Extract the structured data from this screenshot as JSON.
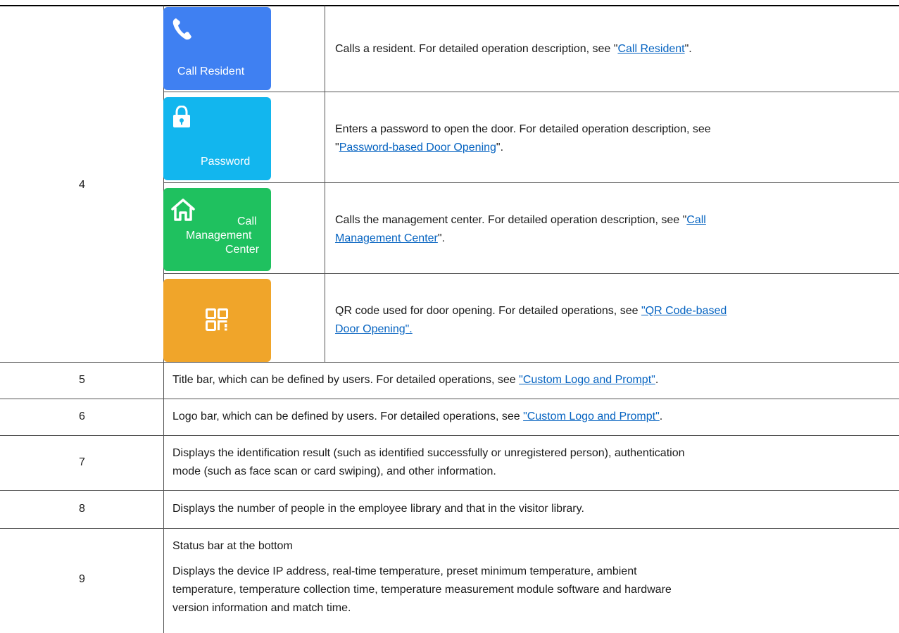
{
  "rows": {
    "r4": {
      "number": "4",
      "tiles": {
        "call": {
          "label": "Call Resident",
          "icon": "phone-icon",
          "color": "#3f80f2"
        },
        "password": {
          "label": "Password",
          "icon": "lock-icon",
          "color": "#12b6ee"
        },
        "management": {
          "label_line1": "Call",
          "label_line2": "Management",
          "label_line3": "Center",
          "icon": "home-icon",
          "color": "#1fc15f"
        },
        "qr": {
          "icon": "qr-code-icon",
          "color": "#f0a52a"
        }
      },
      "descriptions": {
        "call": {
          "text": "Calls a resident. For detailed operation description, see \"",
          "link": "Call Resident",
          "tail": "\"."
        },
        "password": {
          "text": "Enters a password to open the door. For detailed operation description, see",
          "line2_prefix": "\"",
          "link": "Password-based Door Opening",
          "tail": "\"."
        },
        "management": {
          "text": "Calls the management center. For detailed operation description, see \"",
          "link_part1": "Call",
          "link_part2": "Management Center",
          "tail": "\"."
        },
        "qr": {
          "text": "QR code used for door opening. For detailed operations, see ",
          "link_part1": "\"QR Code-based",
          "link_part2": "Door Opening\"."
        }
      }
    },
    "r5": {
      "number": "5",
      "text": "Title bar, which can be defined by users. For detailed operations, see ",
      "link": "\"Custom Logo and Prompt\"",
      "tail": "."
    },
    "r6": {
      "number": "6",
      "text": "Logo bar, which can be defined by users. For detailed operations, see ",
      "link": "\"Custom Logo and Prompt\"",
      "tail": "."
    },
    "r7": {
      "number": "7",
      "line1": "Displays the identification result (such as identified successfully or unregistered person), authentication",
      "line2": "mode (such as face scan or card swiping), and other information."
    },
    "r8": {
      "number": "8",
      "text": "Displays the number of people in the employee library and that in the visitor library."
    },
    "r9": {
      "number": "9",
      "heading": "Status bar at the bottom",
      "line1": "Displays the device IP address, real-time temperature, preset minimum temperature, ambient",
      "line2": "temperature, temperature collection time, temperature measurement module software and hardware",
      "line3": "version information and match time."
    }
  },
  "link_color": "#0563c1"
}
